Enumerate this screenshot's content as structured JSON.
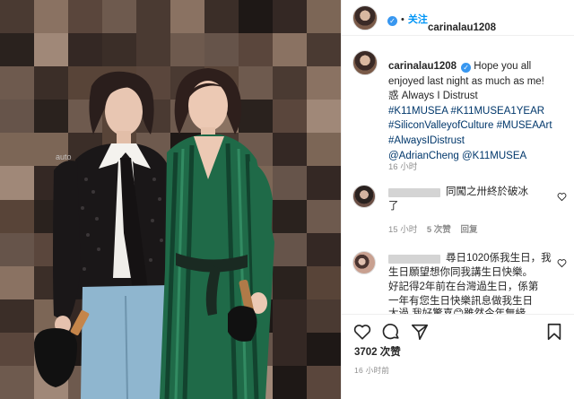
{
  "post": {
    "username": "carinalau1208",
    "verified_icon": "verified-badge-icon",
    "follow_label": "关注",
    "separator": "•"
  },
  "caption": {
    "username": "carinalau1208",
    "lines": [
      "Hope you all",
      "enjoyed last night as much as me!",
      "惑 Always I Distrust"
    ],
    "hashtags_line1": "#K11MUSEA #K11MUSEA1YEAR",
    "hashtags_line2": "#SiliconValleyofCulture #MUSEAArt",
    "hashtags_line3": "#AlwaysIDistrust",
    "mentions": "@AdrianCheng @K11MUSEA",
    "time": "16 小时"
  },
  "comments": [
    {
      "text_line1": "同闖之卅終於破冰",
      "text_line2": "了",
      "time": "15 小时",
      "likes": "5 次赞",
      "reply": "回复"
    },
    {
      "text_line1": "尋日1020係我生日，我",
      "text_line2": "生日願望想你同我講生日快樂。",
      "text_line3": "好記得2年前在台灣過生日，係第",
      "text_line4": "一年有您生日快樂訊息做我生日",
      "text_line5": "太過   我好驚喜😊雖然今年無緣"
    }
  ],
  "actions": {
    "like_icon": "heart-icon",
    "comment_icon": "comment-icon",
    "share_icon": "share-icon",
    "save_icon": "bookmark-icon",
    "likes_count": "3702 次赞",
    "post_time": "16 小时前"
  },
  "colors": {
    "link": "#00376b",
    "follow": "#0095f6",
    "verified": "#3897f0",
    "muted": "#8e8e8e"
  }
}
